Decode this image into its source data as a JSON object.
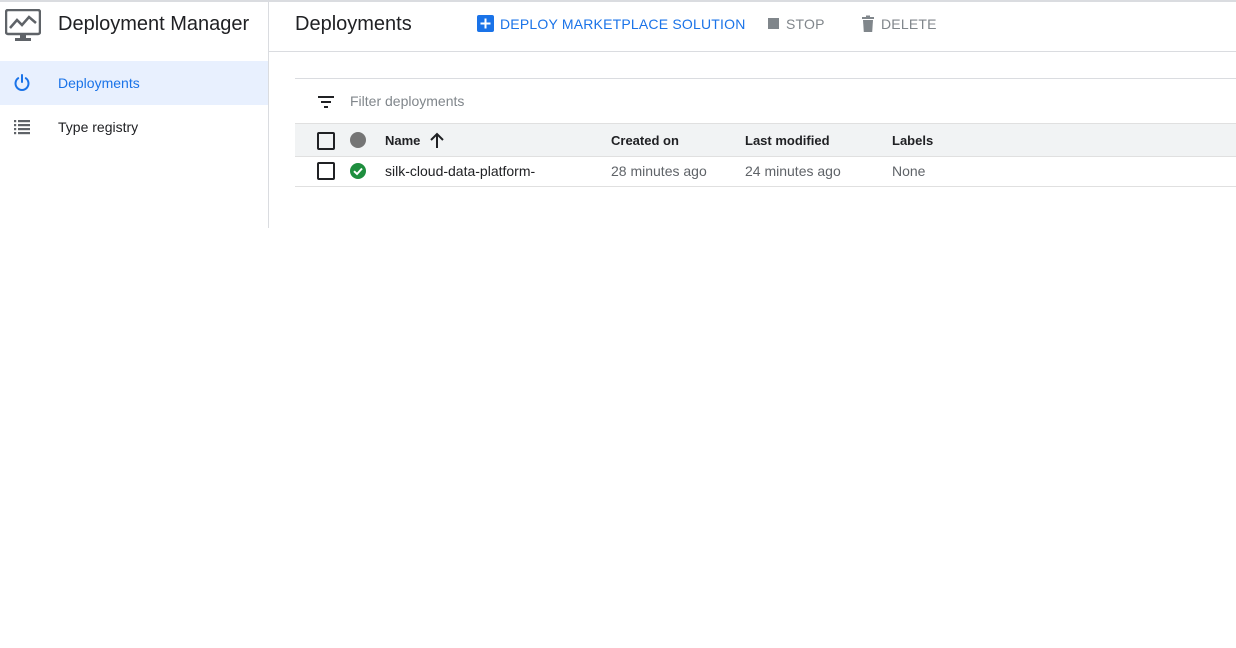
{
  "sidebar": {
    "app_icon": "monitor-chart-icon",
    "app_title": "Deployment Manager",
    "items": [
      {
        "label": "Deployments",
        "icon": "power-icon",
        "active": true
      },
      {
        "label": "Type registry",
        "icon": "list-icon",
        "active": false
      }
    ]
  },
  "header": {
    "title": "Deployments",
    "actions": {
      "deploy": {
        "label": "DEPLOY MARKETPLACE SOLUTION",
        "icon": "add-box-icon"
      },
      "stop": {
        "label": "STOP",
        "icon": "stop-icon"
      },
      "delete": {
        "label": "DELETE",
        "icon": "trash-icon"
      }
    }
  },
  "filter": {
    "placeholder": "Filter deployments",
    "icon": "filter-icon"
  },
  "table": {
    "columns": {
      "name": "Name",
      "created": "Created on",
      "modified": "Last modified",
      "labels": "Labels"
    },
    "sort": {
      "column": "Name",
      "direction": "ascending",
      "icon": "arrow-up-icon"
    },
    "rows": [
      {
        "status": "ok",
        "name": "silk-cloud-data-platform-",
        "created": "28 minutes ago",
        "modified": "24 minutes ago",
        "labels": "None"
      }
    ]
  },
  "colors": {
    "accent": "#1a73e8",
    "active_bg": "#e8f0fe",
    "success": "#1e8e3e",
    "muted": "#5f6368"
  }
}
